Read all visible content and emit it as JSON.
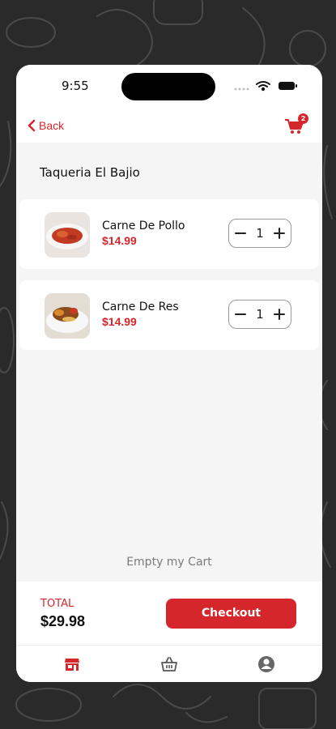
{
  "status_bar": {
    "time": "9:55"
  },
  "nav": {
    "back_label": "Back",
    "cart_count": "2"
  },
  "store": {
    "name": "Taqueria El Bajio"
  },
  "cart_items": [
    {
      "name": "Carne De Pollo",
      "price": "$14.99",
      "quantity": "1",
      "image_icon": "chicken-dish-photo"
    },
    {
      "name": "Carne De Res",
      "price": "$14.99",
      "quantity": "1",
      "image_icon": "beef-dish-photo"
    }
  ],
  "actions": {
    "empty_cart_label": "Empty my Cart",
    "checkout_label": "Checkout"
  },
  "totals": {
    "label": "TOTAL",
    "value": "$29.98"
  },
  "tabs": [
    {
      "icon": "store-icon",
      "active": true
    },
    {
      "icon": "basket-icon",
      "active": false
    },
    {
      "icon": "profile-icon",
      "active": false
    }
  ],
  "colors": {
    "accent": "#d4262b",
    "background": "#2a2a2a",
    "surface": "#f5f5f5"
  }
}
